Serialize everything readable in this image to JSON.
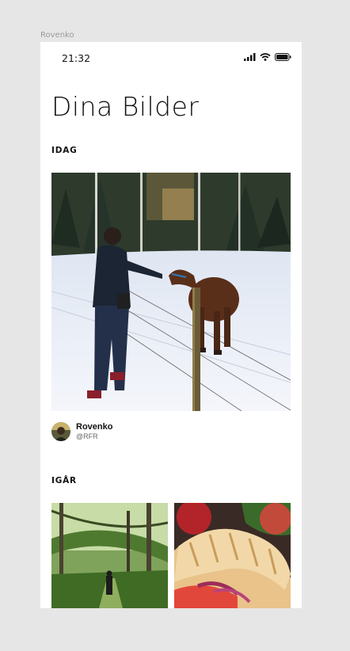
{
  "frame": {
    "label": "Rovenko"
  },
  "status_bar": {
    "time": "21:32",
    "icons": [
      "signal-icon",
      "wifi-icon",
      "battery-icon"
    ]
  },
  "page": {
    "title": "Dina Bilder"
  },
  "sections": [
    {
      "title": "IDAG",
      "photos": [
        "woman-feeding-horse-in-snow"
      ],
      "author": {
        "name": "Rovenko",
        "handle": "@RFR"
      }
    },
    {
      "title": "IGÅR",
      "photos": [
        "person-walking-forest-path",
        "sandwich-closeup"
      ]
    }
  ]
}
